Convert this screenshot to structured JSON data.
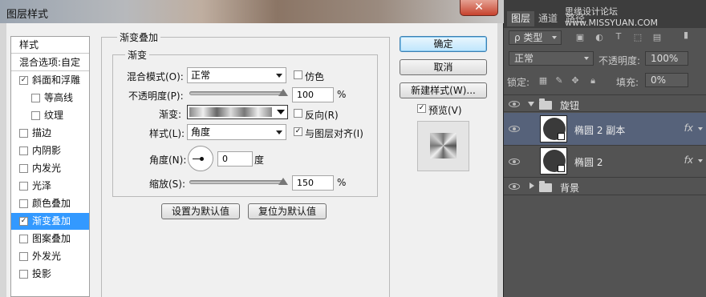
{
  "dialog": {
    "title": "图层样式",
    "close_glyph": "✕",
    "style_list": {
      "header": "样式",
      "blend_header": "混合选项:自定",
      "items": [
        {
          "label": "斜面和浮雕",
          "checked": true,
          "sub": false
        },
        {
          "label": "等高线",
          "checked": false,
          "sub": true
        },
        {
          "label": "纹理",
          "checked": false,
          "sub": true
        },
        {
          "label": "描边",
          "checked": false,
          "sub": false
        },
        {
          "label": "内阴影",
          "checked": false,
          "sub": false
        },
        {
          "label": "内发光",
          "checked": false,
          "sub": false
        },
        {
          "label": "光泽",
          "checked": false,
          "sub": false
        },
        {
          "label": "颜色叠加",
          "checked": false,
          "sub": false
        },
        {
          "label": "渐变叠加",
          "checked": true,
          "sub": false,
          "selected": true
        },
        {
          "label": "图案叠加",
          "checked": false,
          "sub": false
        },
        {
          "label": "外发光",
          "checked": false,
          "sub": false
        },
        {
          "label": "投影",
          "checked": false,
          "sub": false
        }
      ]
    },
    "section_title": "渐变叠加",
    "subsection_title": "渐变",
    "blend_mode": {
      "label": "混合模式(O):",
      "value": "正常"
    },
    "dither": {
      "label": "仿色",
      "checked": false
    },
    "opacity": {
      "label": "不透明度(P):",
      "value": "100",
      "unit": "%",
      "percent": 100
    },
    "gradient": {
      "label": "渐变:"
    },
    "reverse": {
      "label": "反向(R)",
      "checked": false
    },
    "style": {
      "label": "样式(L):",
      "value": "角度"
    },
    "align": {
      "label": "与图层对齐(I)",
      "checked": true
    },
    "angle": {
      "label": "角度(N):",
      "value": "0",
      "unit": "度"
    },
    "scale": {
      "label": "缩放(S):",
      "value": "150",
      "unit": "%",
      "percent": 100
    },
    "set_default": "设置为默认值",
    "reset_default": "复位为默认值",
    "ok": "确定",
    "cancel": "取消",
    "new_style": "新建样式(W)...",
    "preview": {
      "label": "预览(V)",
      "checked": true
    },
    "check_glyph": "✓"
  },
  "layers_panel": {
    "tabs": [
      "图层",
      "通道",
      "路径"
    ],
    "watermark": "思缘设计论坛 www.MISSYUAN.COM",
    "filter_label": "ρ 类型",
    "blend_value": "正常",
    "opacity_label": "不透明度:",
    "opacity_value": "100%",
    "lock_label": "锁定:",
    "fill_label": "填充:",
    "fill_value": "0%",
    "layers": [
      {
        "name": "旋钮",
        "kind": "group",
        "expanded": true
      },
      {
        "name": "椭圆 2 副本",
        "kind": "shape",
        "fx": "fx",
        "selected": true
      },
      {
        "name": "椭圆 2",
        "kind": "shape",
        "fx": "fx"
      },
      {
        "name": "背景",
        "kind": "group",
        "expanded": false
      }
    ]
  },
  "colors": {
    "selection": "#3399ff",
    "panel_bg": "#535353",
    "layer_selected": "#56627a"
  }
}
